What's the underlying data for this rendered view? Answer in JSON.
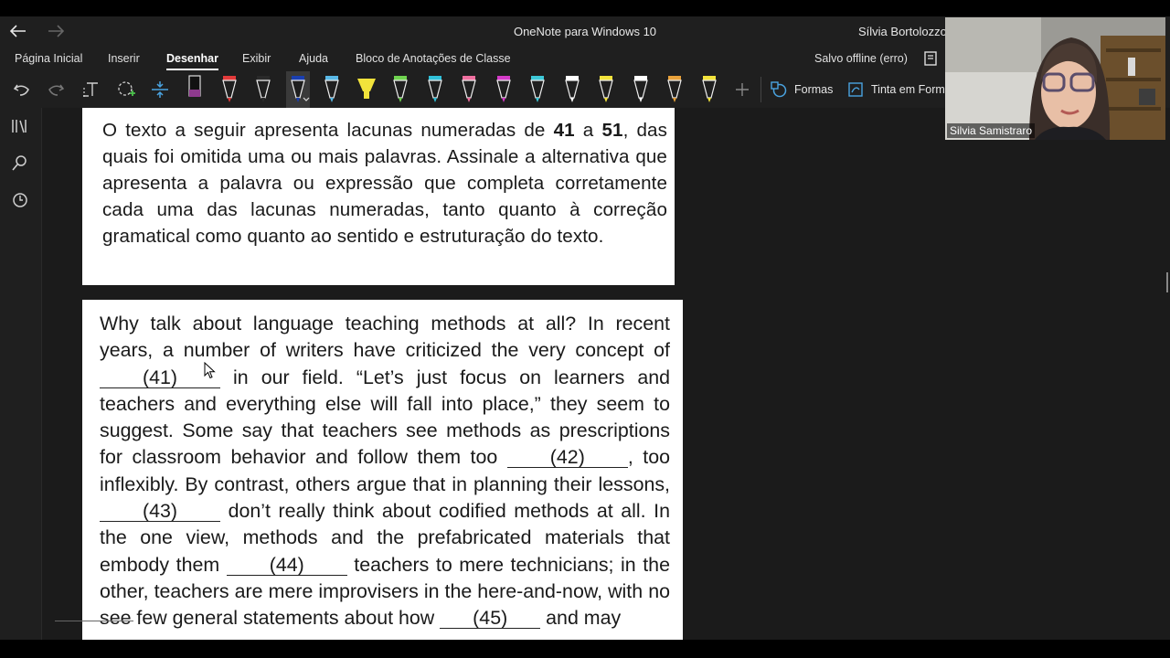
{
  "window": {
    "title": "OneNote para Windows 10",
    "user": "Sílvia Bortolozzo S"
  },
  "menu": {
    "items": [
      "Página Inicial",
      "Inserir",
      "Desenhar",
      "Exibir",
      "Ajuda",
      "Bloco de Anotações de Classe"
    ],
    "active": "Desenhar",
    "status": "Salvo offline (erro)"
  },
  "toolbar": {
    "shapes_label": "Formas",
    "ink_to_shape_label": "Tinta em Forma",
    "pens": [
      {
        "name": "highlighter-black-purple",
        "color": "#222",
        "tip": "#8e3a8e"
      },
      {
        "name": "pen-red",
        "color": "#e23a3a"
      },
      {
        "name": "pen-black",
        "color": "#2a2a2a"
      },
      {
        "name": "pen-blue-selected",
        "color": "#1a3fb0"
      },
      {
        "name": "pen-lightblue",
        "color": "#59b8e6"
      },
      {
        "name": "highlighter-yellow",
        "color": "#f2e33b"
      },
      {
        "name": "pen-green",
        "color": "#6fd34f"
      },
      {
        "name": "pen-cyan",
        "color": "#2fc0d8"
      },
      {
        "name": "pen-pink",
        "color": "#ef6f9f"
      },
      {
        "name": "pen-magenta",
        "color": "#d43ac8"
      },
      {
        "name": "pen-cyan-2",
        "color": "#3dc8d8"
      },
      {
        "name": "pen-white",
        "color": "#ffffff"
      },
      {
        "name": "pen-yellow",
        "color": "#f2e33b"
      },
      {
        "name": "pen-white-2",
        "color": "#ffffff"
      },
      {
        "name": "pen-rainbow",
        "color": "#e8a13a"
      },
      {
        "name": "pen-yellow-2",
        "color": "#f2e33b"
      }
    ]
  },
  "page": {
    "instructions_html": "O texto a seguir apresenta lacunas numeradas de <b>41</b> a <b>51</b>, das quais foi omitida uma ou mais palavras. Assinale a alternativa que apresenta a palavra ou expressão que com&shy;pleta corretamente cada uma das lacunas numeradas, tan&shy;to quanto à correção gramatical como quanto ao sentido e estruturação do texto.",
    "passage": {
      "p1": "Why talk about language teaching methods at all? In recent years, a number of writers have criticized the very concept of",
      "b41": "(41)",
      "p2": "in our field. “Let’s just focus on learners and teachers and everything else will fall into place,” they seem to suggest. Some say that teachers see methods as prescriptions for classroom behavior and follow them too",
      "b42": "(42)",
      "p3": ", too inflexibly. By contrast, others argue that in planning their lessons,",
      "b43": "(43)",
      "p4": "don’t really think about codified methods at all. In the one view, methods and the prefabricated materials that embody them",
      "b44": "(44)",
      "p5": "teachers to mere technicians; in the other, teachers are mere improvisers in the here-and-now, with no",
      "p6": "see few general statements about how",
      "b45": "(45)",
      "p7": "and may"
    }
  },
  "webcam": {
    "name": "Silvia Samistraro"
  },
  "colors": {
    "accent": "#0f6cbd",
    "background": "#1f1f1f"
  }
}
